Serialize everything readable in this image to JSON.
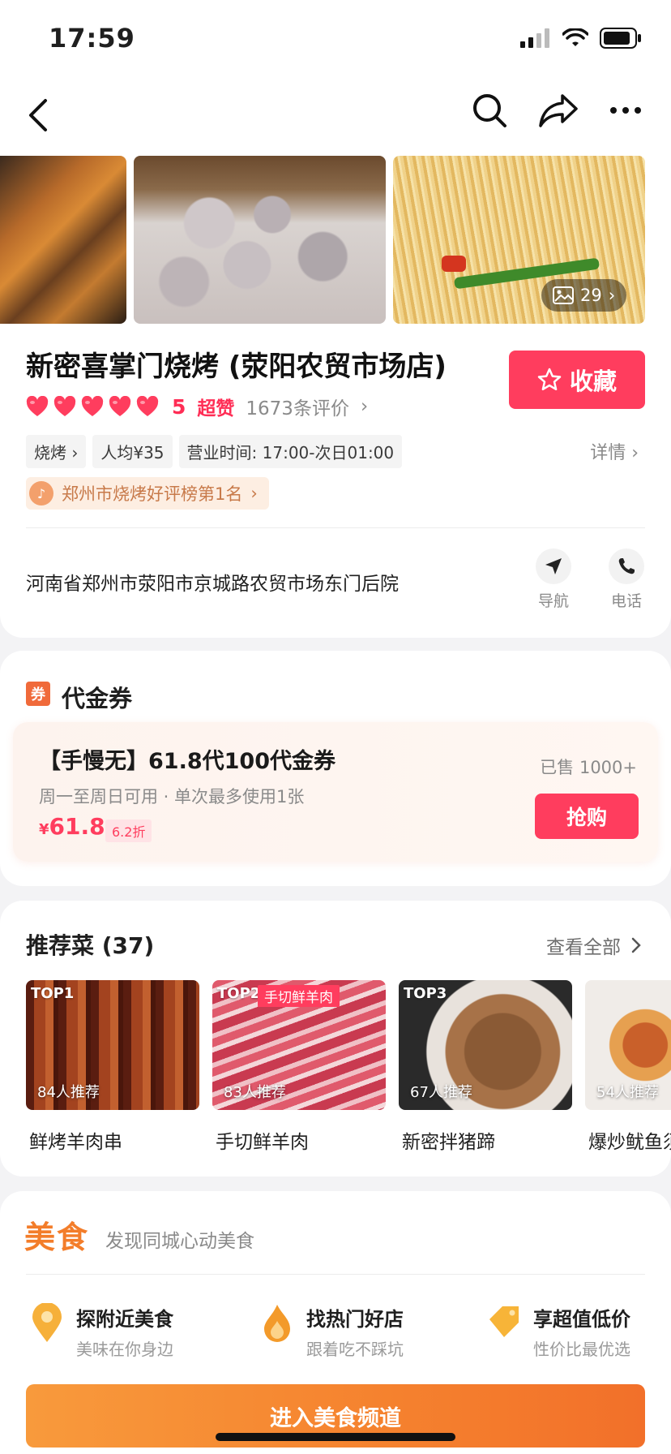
{
  "status_bar": {
    "time": "17:59"
  },
  "photos": {
    "count": "29"
  },
  "store": {
    "name": "新密喜掌门烧烤 (荥阳农贸市场店)",
    "favorite_label": "收藏",
    "rating_score": "5",
    "rating_text": "超赞",
    "reviews": "1673条评价",
    "tags": [
      "烧烤",
      "人均¥35",
      "营业时间: 17:00-次日01:00"
    ],
    "detail_label": "详情",
    "rank": "郑州市烧烤好评榜第1名",
    "address": "河南省郑州市荥阳市京城路农贸市场东门后院",
    "nav_label": "导航",
    "phone_label": "电话"
  },
  "voucher": {
    "section_icon": "券",
    "section_title": "代金券",
    "title": "【手慢无】61.8代100代金券",
    "subtitle": "周一至周日可用 · 单次最多使用1张",
    "price_symbol": "¥",
    "price": "61.8",
    "discount": "6.2折",
    "sold": "已售 1000+",
    "buy_label": "抢购"
  },
  "dishes": {
    "title": "推荐菜 (37)",
    "view_all": "查看全部",
    "items": [
      {
        "top": "TOP1",
        "label": "",
        "rec": "84人推荐",
        "name": "鲜烤羊肉串"
      },
      {
        "top": "TOP2",
        "label": "手切鲜羊肉",
        "rec": "83人推荐",
        "name": "手切鲜羊肉"
      },
      {
        "top": "TOP3",
        "label": "",
        "rec": "67人推荐",
        "name": "新密拌猪蹄"
      },
      {
        "top": "",
        "label": "",
        "rec": "54人推荐",
        "name": "爆炒鱿鱼须"
      }
    ]
  },
  "food": {
    "logo": "美食",
    "slogan": "发现同城心动美食",
    "features": [
      {
        "title": "探附近美食",
        "sub": "美味在你身边"
      },
      {
        "title": "找热门好店",
        "sub": "跟着吃不踩坑"
      },
      {
        "title": "享超值低价",
        "sub": "性价比最优选"
      }
    ],
    "button": "进入美食频道"
  },
  "colors": {
    "accent": "#ff3d5e",
    "food_orange": "#f37d2a"
  }
}
